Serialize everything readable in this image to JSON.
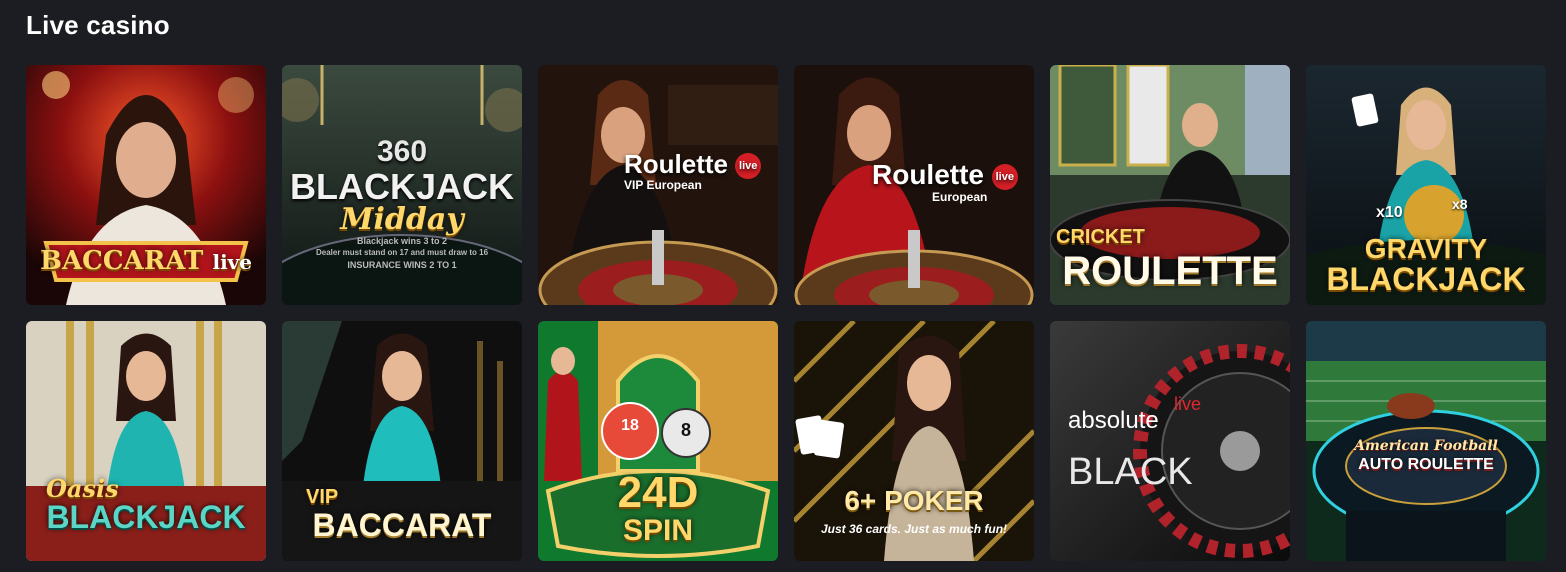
{
  "section": {
    "title": "Live casino"
  },
  "games": [
    {
      "name": "baccarat-live",
      "title": "BACCARAT",
      "badge": "live"
    },
    {
      "name": "blackjack-360-midday",
      "top": "360",
      "title": "BLACKJACK",
      "subtitle": "Midday",
      "line1": "Blackjack wins 3 to 2",
      "line2": "Dealer must stand on 17 and must draw to 16",
      "line3": "INSURANCE WINS 2 TO 1"
    },
    {
      "name": "roulette-vip-european",
      "title": "Roulette",
      "badge": "live",
      "subtitle": "VIP European"
    },
    {
      "name": "roulette-european",
      "title": "Roulette",
      "badge": "live",
      "subtitle": "European"
    },
    {
      "name": "cricket-roulette",
      "top": "CRICKET",
      "title": "ROULETTE"
    },
    {
      "name": "gravity-blackjack",
      "top": "GRAVITY",
      "title": "BLACKJACK",
      "m1": "x10",
      "m2": "x8"
    },
    {
      "name": "oasis-blackjack",
      "top": "Oasis",
      "title": "BLACKJACK"
    },
    {
      "name": "vip-baccarat",
      "top": "VIP",
      "title": "BACCARAT"
    },
    {
      "name": "24d-spin",
      "title": "24D",
      "subtitle": "SPIN",
      "ball1": "18",
      "ball2": "8"
    },
    {
      "name": "6-plus-poker",
      "title": "6+ POKER",
      "subtitle": "Just 36 cards. Just as much fun!"
    },
    {
      "name": "absolute-black",
      "top": "absolute",
      "badge": "live",
      "title": "BLACK"
    },
    {
      "name": "american-football-auto-roulette",
      "top": "American Football",
      "title": "AUTO ROULETTE"
    }
  ]
}
